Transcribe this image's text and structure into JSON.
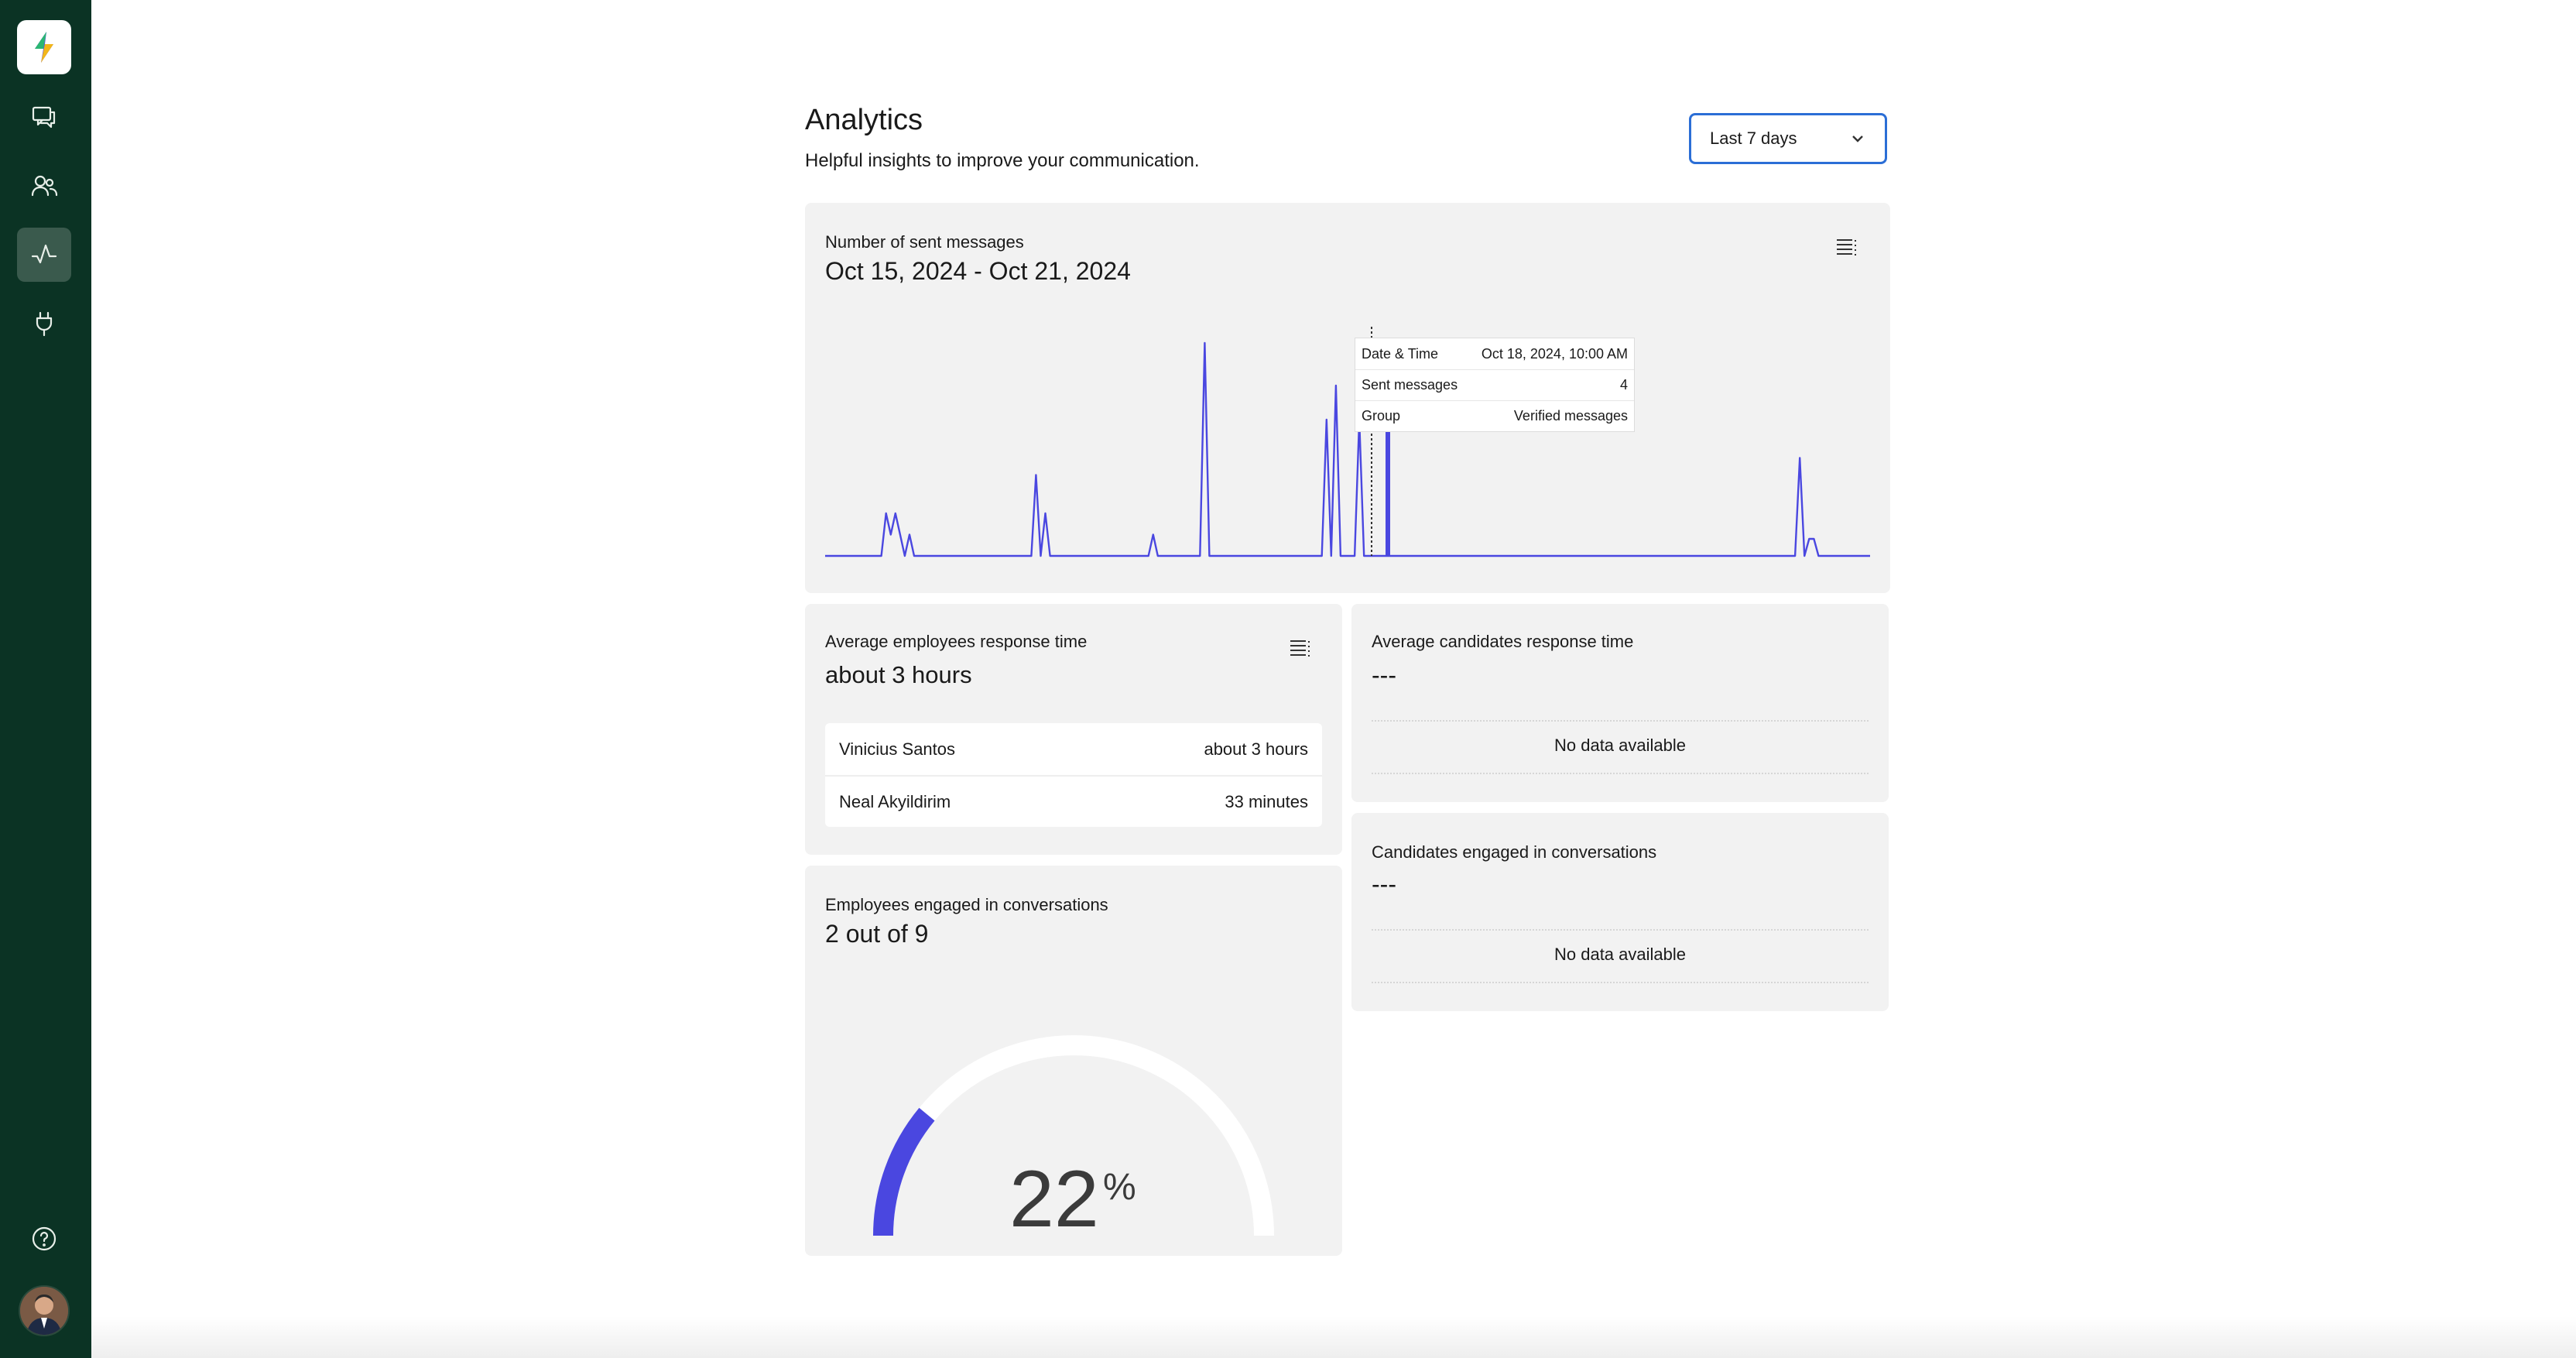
{
  "sidebar": {
    "items": [
      {
        "name": "conversations",
        "icon": "chat-bubbles-icon",
        "active": false
      },
      {
        "name": "contacts",
        "icon": "users-icon",
        "active": false
      },
      {
        "name": "analytics",
        "icon": "activity-icon",
        "active": true
      },
      {
        "name": "integrations",
        "icon": "plug-icon",
        "active": false
      }
    ],
    "help_icon": "help-circle-icon"
  },
  "header": {
    "title": "Analytics",
    "subtitle": "Helpful insights to improve your communication.",
    "range_select": {
      "value": "Last 7 days"
    }
  },
  "sent_messages": {
    "label": "Number of sent messages",
    "range": "Oct 15, 2024 - Oct 21, 2024",
    "tooltip": {
      "rows": [
        {
          "key": "Date & Time",
          "value": "Oct 18, 2024, 10:00 AM"
        },
        {
          "key": "Sent messages",
          "value": "4"
        },
        {
          "key": "Group",
          "value": "Verified messages"
        }
      ]
    }
  },
  "chart_data": {
    "type": "line",
    "series": [
      {
        "color": "#4a47e0",
        "values": [
          0,
          0,
          0,
          0,
          0,
          0,
          0,
          0,
          0,
          0,
          0,
          0,
          0,
          1,
          0.5,
          1,
          0.5,
          0,
          0.5,
          0,
          0,
          0,
          0,
          0,
          0,
          0,
          0,
          0,
          0,
          0,
          0,
          0,
          0,
          0,
          0,
          0,
          0,
          0,
          0,
          0,
          0,
          0,
          0,
          0,
          0,
          1.9,
          0,
          1,
          0,
          0,
          0,
          0,
          0,
          0,
          0,
          0,
          0,
          0,
          0,
          0,
          0,
          0,
          0,
          0,
          0,
          0,
          0,
          0,
          0,
          0,
          0.5,
          0,
          0,
          0,
          0,
          0,
          0,
          0,
          0,
          0,
          0,
          5,
          0,
          0,
          0,
          0,
          0,
          0,
          0,
          0,
          0,
          0,
          0,
          0,
          0,
          0,
          0,
          0,
          0,
          0,
          0,
          0,
          0,
          0,
          0,
          0,
          0,
          3.2,
          0,
          4,
          0,
          0,
          0,
          0,
          3.2,
          0,
          0,
          0,
          0,
          0,
          0,
          0,
          0,
          0,
          0,
          0,
          0,
          0,
          0,
          0,
          0,
          0,
          0,
          0,
          0,
          0,
          0,
          0,
          0,
          0,
          0,
          0,
          0,
          0,
          0,
          0,
          0,
          0,
          0,
          0,
          0,
          0,
          0,
          0,
          0,
          0,
          0,
          0,
          0,
          0,
          0,
          0,
          0,
          0,
          0,
          0,
          0,
          0,
          0,
          0,
          0,
          0,
          0,
          0,
          0,
          0,
          0,
          0,
          0,
          0,
          0,
          0,
          0,
          0,
          0,
          0,
          0,
          0,
          0,
          0,
          0,
          0,
          0,
          0,
          0,
          0,
          0,
          0,
          0,
          0,
          0,
          0,
          0,
          0,
          0,
          0,
          0,
          0,
          2.3,
          0,
          0.4,
          0.4,
          0,
          0,
          0,
          0,
          0,
          0,
          0,
          0,
          0,
          0,
          0,
          0
        ]
      }
    ],
    "ylim": [
      0,
      5.2
    ],
    "grid": false,
    "legend": "none"
  },
  "employees_response": {
    "label": "Average employees response time",
    "value": "about 3 hours",
    "rows": [
      {
        "name": "Vinicius Santos",
        "value": "about 3 hours"
      },
      {
        "name": "Neal Akyildirim",
        "value": "33 minutes"
      }
    ]
  },
  "candidates_response": {
    "label": "Average candidates response time",
    "value": "---",
    "empty": "No data available"
  },
  "candidates_engaged": {
    "label": "Candidates engaged in conversations",
    "value": "---",
    "empty": "No data available"
  },
  "employees_engaged": {
    "label": "Employees engaged in conversations",
    "value": "2 out of 9",
    "percent": "22",
    "percent_sign": "%",
    "fraction": 0.22,
    "color": "#4a47e0"
  }
}
